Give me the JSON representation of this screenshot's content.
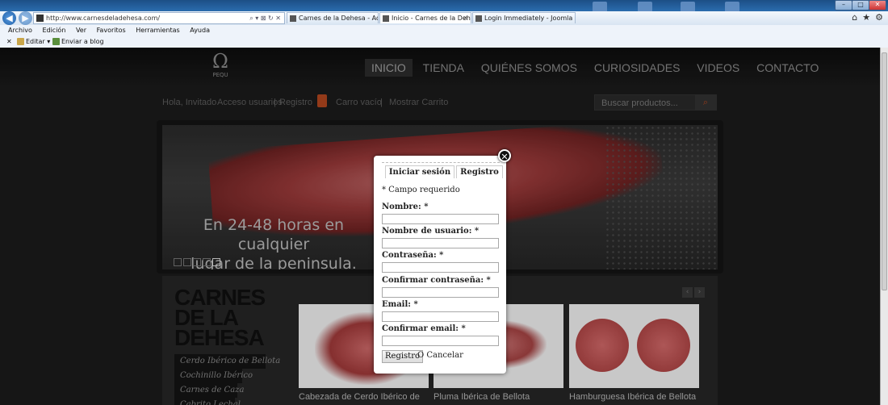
{
  "browser": {
    "address_url": "http://www.carnesdeladehesa.com/",
    "tabs": [
      {
        "label": "Carnes de la Dehesa - Adminis..."
      },
      {
        "label": "Inicio - Carnes de la Dehesa"
      },
      {
        "label": "Login Immediately - Joomla Ex..."
      }
    ],
    "menu": [
      "Archivo",
      "Edición",
      "Ver",
      "Favoritos",
      "Herramientas",
      "Ayuda"
    ],
    "command_editar": "Editar",
    "command_blog": "Enviar a blog",
    "window_min": "–",
    "window_max": "□",
    "window_close": "✕"
  },
  "site": {
    "logo_text": "PEQU",
    "nav": [
      "INICIO",
      "TIENDA",
      "QUIÉNES SOMOS",
      "CURIOSIDADES",
      "VIDEOS",
      "CONTACTO"
    ],
    "greeting": "Hola, Invitado",
    "login_link": "Acceso usuarios",
    "separator": "|",
    "register_link": "Registro",
    "cart_empty": "Carro vacío",
    "show_cart": "Mostrar Carrito",
    "search_placeholder": "Buscar productos...",
    "slide_caption_line1": "En 24-48 horas en cualquier",
    "slide_caption_line2": "lugar de la peninsula.",
    "products_title_1": "CARNES",
    "products_title_2": "DE LA",
    "products_title_3": "DEHESA",
    "categories": [
      "Cerdo Ibérico de Bellota",
      "Cochinillo Ibérico",
      "Carnes de Caza",
      "Cabrito Lechal"
    ],
    "products": [
      {
        "name": "Cabezada de Cerdo Ibérico de"
      },
      {
        "name": "Pluma Ibérica de Bellota"
      },
      {
        "name": "Hamburguesa Ibérica de Bellota"
      }
    ],
    "arrow_prev": "‹",
    "arrow_next": "›"
  },
  "modal": {
    "tab_login": "Iniciar sesión",
    "tab_register": "Registro",
    "required_note": "* Campo requerido",
    "fields": [
      {
        "label": "Nombre: *"
      },
      {
        "label": "Nombre de usuario: *"
      },
      {
        "label": "Contraseña: *"
      },
      {
        "label": "Confirmar contraseña: *"
      },
      {
        "label": "Email: *"
      },
      {
        "label": "Confirmar email: *"
      }
    ],
    "submit_label": "Registro",
    "cancel_text": "O Cancelar",
    "close_symbol": "✕"
  }
}
